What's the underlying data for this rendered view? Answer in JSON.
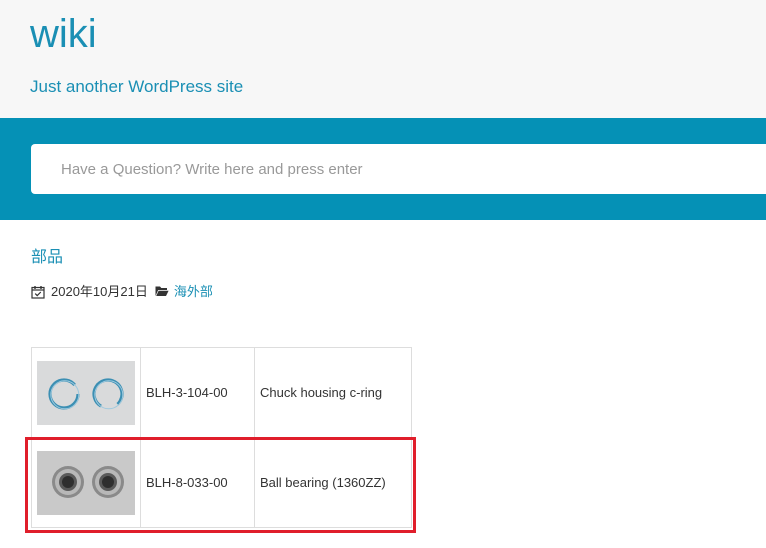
{
  "site": {
    "title": "wiki",
    "tagline": "Just another WordPress site"
  },
  "search": {
    "placeholder": "Have a Question? Write here and press enter"
  },
  "post": {
    "title": "部品",
    "date": "2020年10月21日",
    "category": "海外部"
  },
  "parts_table": {
    "rows": [
      {
        "image": "c-ring-photo",
        "code": "BLH-3-104-00",
        "description": "Chuck housing c-ring"
      },
      {
        "image": "ball-bearing-photo",
        "code": "BLH-8-033-00",
        "description": "Ball bearing (1360ZZ)"
      }
    ]
  },
  "colors": {
    "brand": "#1a8fb4",
    "search_band": "#0591b6",
    "header_bg": "#f7f7f7",
    "highlight": "#e01e2b"
  },
  "icons": {
    "date": "calendar-check-icon",
    "category": "folder-open-icon"
  }
}
